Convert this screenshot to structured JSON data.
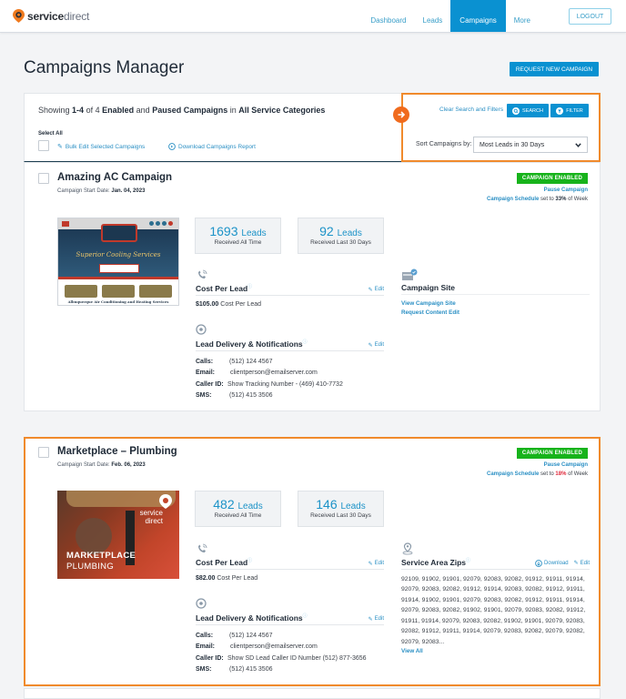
{
  "header": {
    "logo_bold": "service",
    "logo_light": "direct",
    "nav": [
      {
        "label": "Dashboard",
        "active": false
      },
      {
        "label": "Leads",
        "active": false
      },
      {
        "label": "Campaigns",
        "active": true
      },
      {
        "label": "More",
        "active": false
      }
    ],
    "logout_label": "LOGOUT"
  },
  "page": {
    "title": "Campaigns Manager",
    "request_button": "REQUEST NEW CAMPAIGN"
  },
  "summary": {
    "showing_prefix": "Showing",
    "range": "1-4",
    "of": "of",
    "total": "4",
    "enabled": "Enabled",
    "and": "and",
    "paused_campaigns": "Paused Campaigns",
    "in": "in",
    "category": "All Service Categories",
    "select_all": "Select All",
    "bulk_edit": "Bulk Edit Selected Campaigns",
    "download_report": "Download Campaigns Report"
  },
  "filters": {
    "clear": "Clear Search and Filters",
    "search": "SEARCH",
    "filter": "FILTER",
    "sort_label": "Sort Campaigns by:",
    "sort_value": "Most Leads in 30 Days"
  },
  "colors": {
    "accent": "#0a91d1",
    "highlight": "#f08a2c",
    "enabled_badge": "#17b31b"
  },
  "campaigns": [
    {
      "name": "Amazing AC Campaign",
      "start_label": "Campaign Start Date:",
      "start_date": "Jan. 04, 2023",
      "status": "CAMPAIGN ENABLED",
      "pause": "Pause Campaign",
      "schedule_link": "Campaign Schedule",
      "schedule_mid": "set to",
      "schedule_pct": "33%",
      "schedule_end": "of Week",
      "leads_all": "1693",
      "leads_all_unit": "Leads",
      "leads_all_sub": "Received All Time",
      "leads_30": "92",
      "leads_30_unit": "Leads",
      "leads_30_sub": "Received Last 30 Days",
      "cpl_title": "Cost Per Lead",
      "cpl_amount": "$105.00",
      "cpl_suffix": "Cost Per Lead",
      "edit": "Edit",
      "delivery_title": "Lead Delivery & Notifications",
      "calls_k": "Calls:",
      "calls": "(512) 124 4567",
      "email_k": "Email:",
      "email": "clientperson@emailserver.com",
      "callerid_k": "Caller ID:",
      "callerid": "Show Tracking Number - (469) 410-7732",
      "sms_k": "SMS:",
      "sms": "(512) 415 3506",
      "site_title": "Campaign Site",
      "view_site": "View Campaign Site",
      "request_edit": "Request Content Edit",
      "thumb_caption": "Albuquerque Air Conditioning and Heating Services",
      "thumb_headline": "Superior Cooling Services"
    },
    {
      "name": "Marketplace – Plumbing",
      "start_label": "Campaign Start Date:",
      "start_date": "Feb. 06, 2023",
      "status": "CAMPAIGN ENABLED",
      "pause": "Pause Campaign",
      "schedule_link": "Campaign Schedule",
      "schedule_mid": "set to",
      "schedule_pct": "18%",
      "schedule_end": "of Week",
      "leads_all": "482",
      "leads_all_unit": "Leads",
      "leads_all_sub": "Received All Time",
      "leads_30": "146",
      "leads_30_unit": "Leads",
      "leads_30_sub": "Received Last 30 Days",
      "cpl_title": "Cost Per Lead",
      "cpl_amount": "$82.00",
      "cpl_suffix": "Cost Per Lead",
      "edit": "Edit",
      "delivery_title": "Lead Delivery & Notifications",
      "calls_k": "Calls:",
      "calls": "(512) 124 4567",
      "email_k": "Email:",
      "email": "clientperson@emailserver.com",
      "callerid_k": "Caller ID:",
      "callerid": "Show SD Lead Caller ID Number (512) 877-3656",
      "sms_k": "SMS:",
      "sms": "(512) 415 3506",
      "zips_title": "Service Area Zips",
      "zips_download": "Download",
      "zips": "92109, 91902, 91901, 92079, 92083, 92082, 91912, 91911, 91914, 92079, 92083, 92082, 91912, 91914, 92083, 92082, 91912, 91911, 91914, 91902, 91901, 92079, 92083, 92082, 91912, 91911, 91914, 92079, 92083, 92082, 91902, 91901, 92079, 92083, 92082, 91912, 91911, 91914, 92079, 92083, 92082, 91902, 91901, 92079, 92083, 92082, 91912, 91911, 91914, 92079, 92083, 92082, 92079, 92082, 92079, 92083...",
      "view_all": "View All",
      "thumb_brand_1": "service",
      "thumb_brand_2": "direct",
      "thumb_title_1": "MARKETPLACE",
      "thumb_title_2": "PLUMBING"
    }
  ]
}
